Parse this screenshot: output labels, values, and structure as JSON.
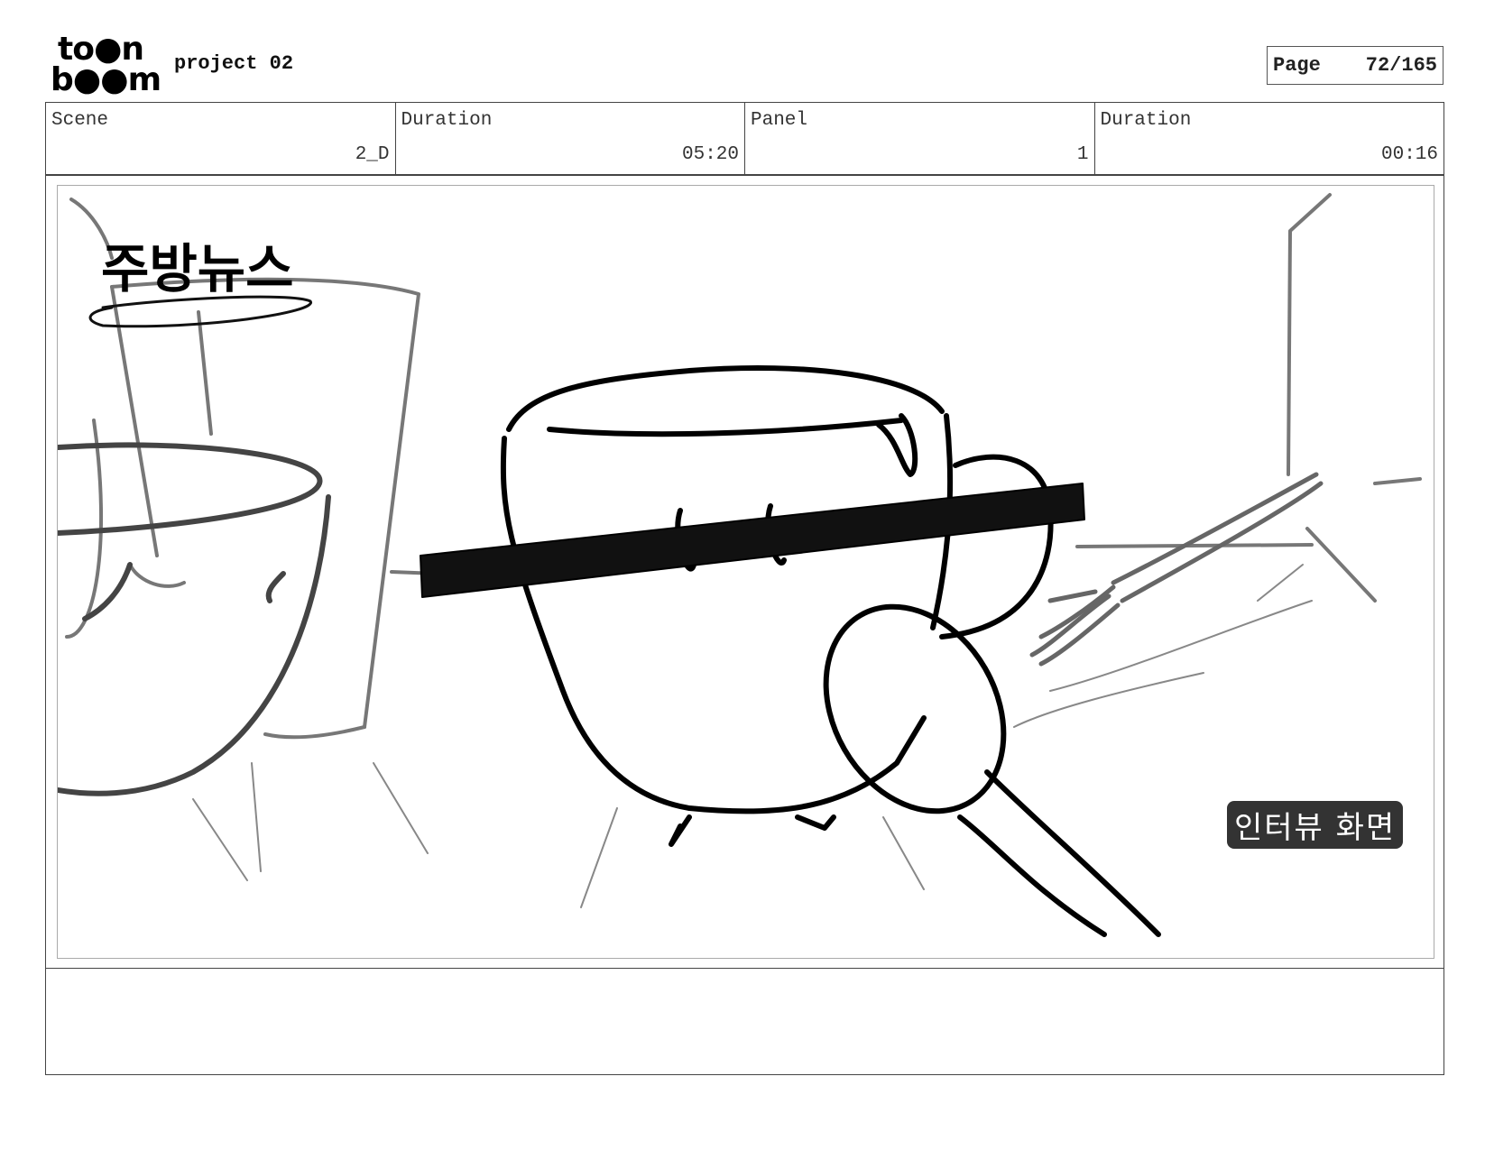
{
  "header": {
    "logo_top": "to●n",
    "logo_bottom": "b●●m",
    "project_title": "project 02",
    "page_label": "Page",
    "page_value": "72/165"
  },
  "info": [
    {
      "label": "Scene",
      "value": "2_D"
    },
    {
      "label": "Duration",
      "value": "05:20"
    },
    {
      "label": "Panel",
      "value": "1"
    },
    {
      "label": "Duration",
      "value": "00:16"
    }
  ],
  "panel": {
    "handwritten_title": "주방뉴스",
    "caption_tag": "인터뷰 화면"
  },
  "notes": ""
}
